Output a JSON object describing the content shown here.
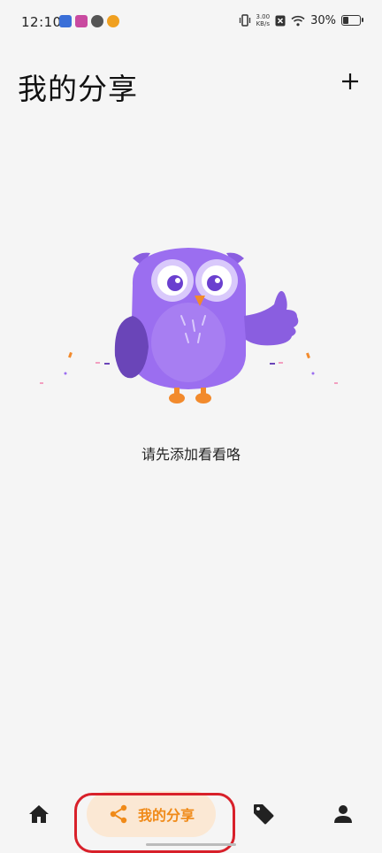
{
  "status_bar": {
    "time": "12:10",
    "net_speed": "3.00",
    "net_unit": "KB/s",
    "battery": "30%",
    "battery_level": 0.3
  },
  "header": {
    "title": "我的分享",
    "add_icon": "plus-icon"
  },
  "empty_state": {
    "illustration": "owl-thumbs-up",
    "message": "请先添加看看咯"
  },
  "bottom_nav": {
    "items": [
      {
        "icon": "home-icon"
      },
      {
        "icon": "share-icon",
        "label": "我的分享",
        "active": true
      },
      {
        "icon": "tag-icon"
      },
      {
        "icon": "person-icon"
      }
    ],
    "active_color": "#f08a18",
    "active_bg": "#fbe8d4"
  },
  "colors": {
    "owl_body": "#9b6ef0",
    "owl_wing": "#6a45b8",
    "owl_feet": "#f28a2c",
    "highlight": "#d8202a"
  }
}
